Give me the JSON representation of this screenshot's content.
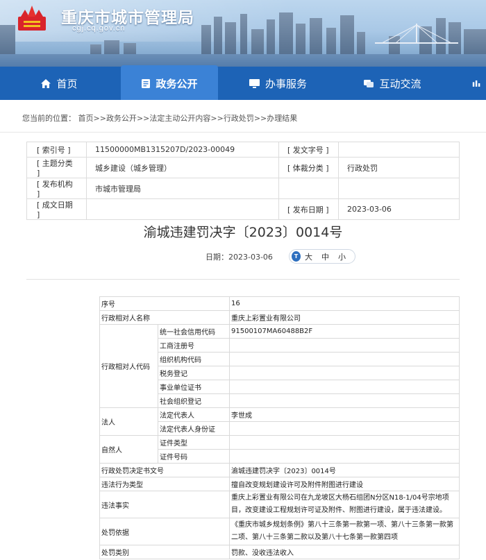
{
  "site": {
    "title": "重庆市城市管理局",
    "url": "cgj.cq.gov.cn"
  },
  "nav": [
    {
      "label": "首页",
      "icon": "home-icon"
    },
    {
      "label": "政务公开",
      "icon": "document-icon",
      "active": true
    },
    {
      "label": "办事服务",
      "icon": "monitor-icon"
    },
    {
      "label": "互动交流",
      "icon": "chat-icon"
    }
  ],
  "breadcrumb": {
    "prefix": "您当前的位置：",
    "items": [
      "首页",
      "政务公开",
      "法定主动公开内容",
      "行政处罚",
      "办理结果"
    ],
    "separator": ">>"
  },
  "meta": {
    "rows": [
      {
        "k1": "[ 索引号 ]",
        "v1": "11500000MB1315207D/2023-00049",
        "k2": "[ 发文字号 ]",
        "v2": ""
      },
      {
        "k1": "[ 主题分类 ]",
        "v1": "城乡建设（城乡管理）",
        "k2": "[ 体裁分类 ]",
        "v2": "行政处罚"
      },
      {
        "k1": "[ 发布机构 ]",
        "v1": "市城市管理局",
        "k2": "",
        "v2": ""
      },
      {
        "k1": "[ 成文日期 ]",
        "v1": "",
        "k2": "[ 发布日期 ]",
        "v2": "2023-03-06"
      }
    ]
  },
  "doc": {
    "title": "渝城违建罚决字〔2023〕0014号",
    "date_label": "日期：",
    "date": "2023-03-06",
    "size_icon": "T",
    "sizes": [
      "大",
      "中",
      "小"
    ]
  },
  "table": {
    "seq_label": "序号",
    "seq": "16",
    "party_label": "行政相对人名称",
    "party": "重庆上彩置业有限公司",
    "code_label": "行政相对人代码",
    "codes": [
      {
        "k": "统一社会信用代码",
        "v": "91500107MA60488B2F"
      },
      {
        "k": "工商注册号",
        "v": ""
      },
      {
        "k": "组织机构代码",
        "v": ""
      },
      {
        "k": "税务登记",
        "v": ""
      },
      {
        "k": "事业单位证书",
        "v": ""
      },
      {
        "k": "社会组织登记",
        "v": ""
      }
    ],
    "legal_label": "法人",
    "legal": [
      {
        "k": "法定代表人",
        "v": "李世成"
      },
      {
        "k": "法定代表人身份证",
        "v": ""
      }
    ],
    "person_label": "自然人",
    "person": [
      {
        "k": "证件类型",
        "v": ""
      },
      {
        "k": "证件号码",
        "v": ""
      }
    ],
    "decision_label": "行政处罚决定书文号",
    "decision": "渝城违建罚决字〔2023〕0014号",
    "type_label": "违法行为类型",
    "type": "擅自改变规划建设许可及附件附图进行建设",
    "facts_label": "违法事实",
    "facts": "重庆上彩置业有限公司在九龙坡区大杨石组团N分区N18-1/04号宗地项目，改变建设工程规划许可证及附件、附图进行建设，属于违法建设。",
    "basis_label": "处罚依据",
    "basis": "《重庆市城乡规划条例》第八十三条第一款第一项、第八十三条第一款第二项、第八十三条第二款以及第八十七条第一款第四项",
    "category_label": "处罚类别",
    "category": "罚款、没收违法收入"
  },
  "colors": {
    "nav": "#1d63b6",
    "nav_active": "#3b82d6",
    "title": "#ffffff"
  }
}
